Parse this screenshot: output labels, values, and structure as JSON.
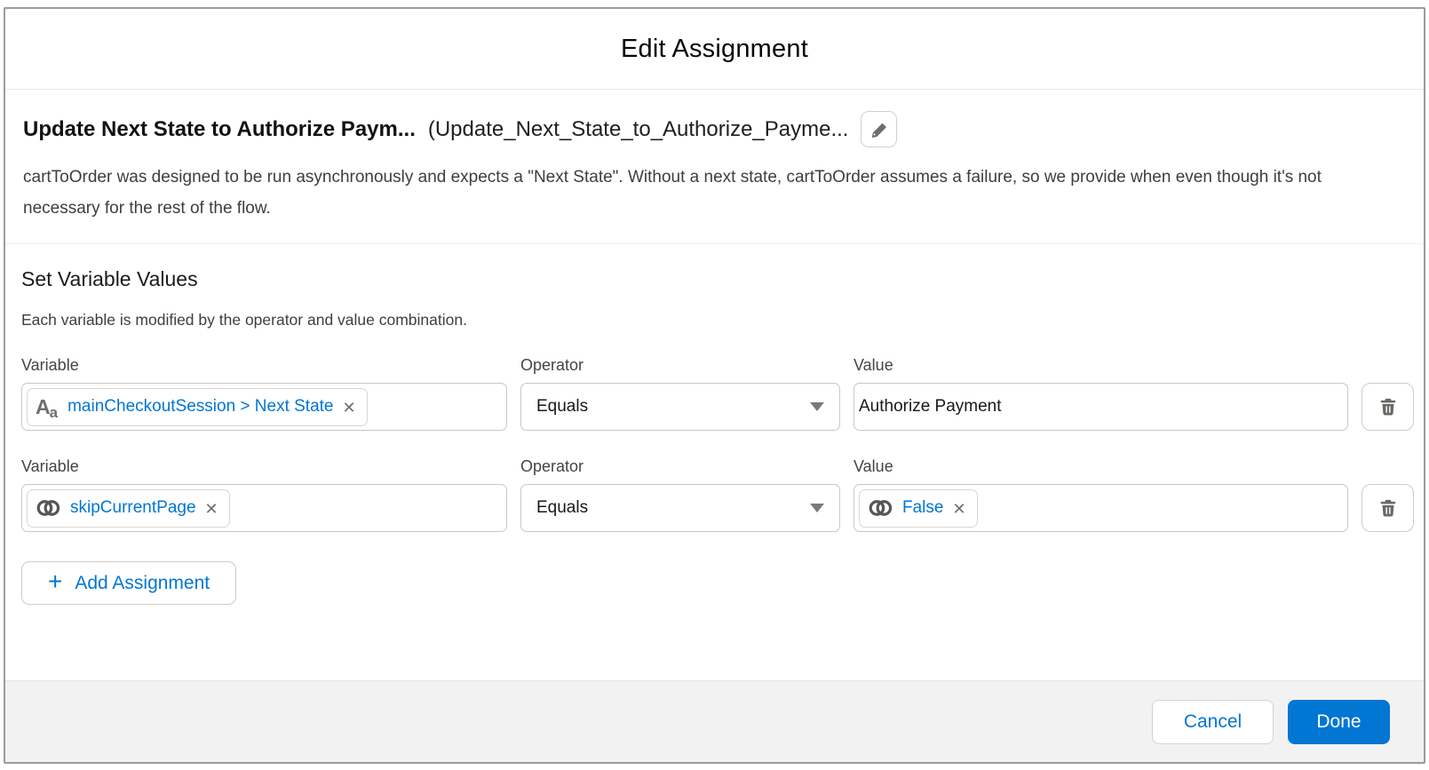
{
  "dialog": {
    "title": "Edit Assignment",
    "header": {
      "label": "Update Next State to Authorize Paym...",
      "api_name": "(Update_Next_State_to_Authorize_Payme...",
      "description": "cartToOrder was designed to be run asynchronously and expects a \"Next State\". Without a next state, cartToOrder assumes a failure, so we provide when even though it's not necessary for the rest of the flow."
    },
    "section": {
      "heading": "Set Variable Values",
      "subheading": "Each variable is modified by the operator and value combination."
    },
    "labels": {
      "variable": "Variable",
      "operator": "Operator",
      "value": "Value"
    },
    "assignments": [
      {
        "variable": {
          "icon": "text-type-icon",
          "text": "mainCheckoutSession > Next State"
        },
        "operator": "Equals",
        "value": {
          "type": "text-input",
          "text": "Authorize Payment"
        }
      },
      {
        "variable": {
          "icon": "boolean-toggle-icon",
          "text": "skipCurrentPage"
        },
        "operator": "Equals",
        "value": {
          "type": "pill",
          "icon": "boolean-toggle-icon",
          "text": "False"
        }
      }
    ],
    "add_button_label": "Add Assignment",
    "footer": {
      "cancel_label": "Cancel",
      "done_label": "Done"
    },
    "colors": {
      "accent": "#0176d3",
      "footer_bg": "#f3f2f2",
      "icon_gray": "#706e6b"
    }
  }
}
